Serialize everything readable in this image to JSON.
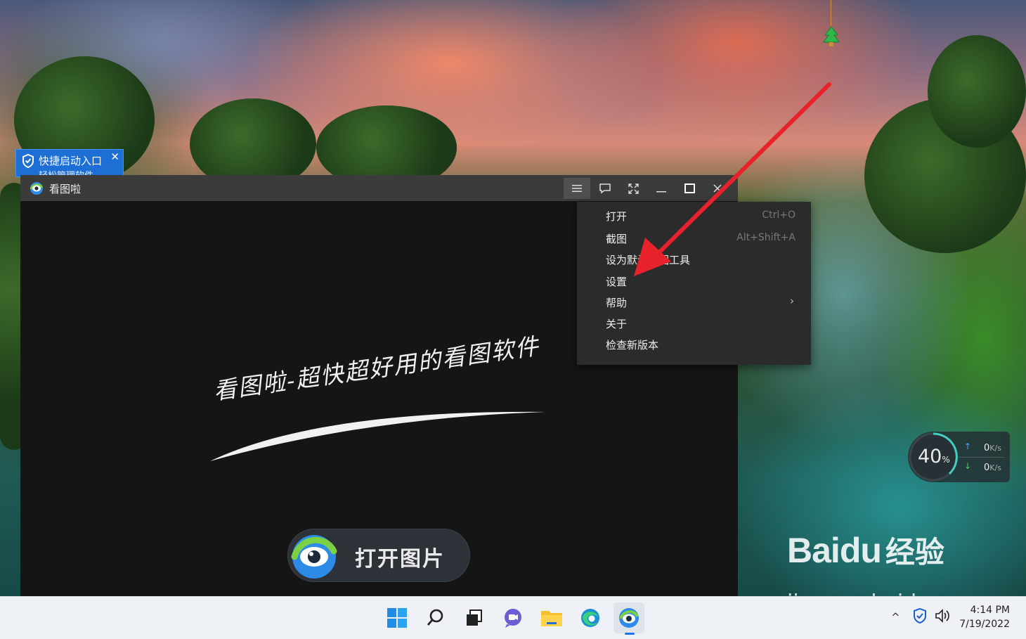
{
  "desktop": {
    "quick_launch": {
      "title": "快捷启动入口",
      "subtitle": "轻松管理软件",
      "close": "✕"
    },
    "net_widget": {
      "cpu_value": "40",
      "cpu_unit": "%",
      "upload_value": "0",
      "upload_unit": "K/s",
      "download_value": "0",
      "download_unit": "K/s",
      "cpu_fraction": 0.4
    },
    "watermark": {
      "brand": "Bai",
      "brand2": "du",
      "cn": "经验",
      "url": "jingyan.baidu.com"
    }
  },
  "window": {
    "title": "看图啦",
    "buttons": {
      "menu": "menu-icon",
      "feedback": "chat-bubble-icon",
      "fullscreen": "fullscreen-icon",
      "minimize": "minimize-icon",
      "maximize": "maximize-icon",
      "close": "close-icon"
    },
    "slogan": "看图啦-超快超好用的看图软件",
    "open_button": "打开图片"
  },
  "menu": {
    "items": [
      {
        "label": "打开",
        "shortcut": "Ctrl+O"
      },
      {
        "label": "截图",
        "shortcut": "Alt+Shift+A"
      },
      {
        "label": "设为默认看图工具",
        "shortcut": ""
      },
      {
        "label": "设置",
        "shortcut": ""
      },
      {
        "label": "帮助",
        "submenu": "›"
      },
      {
        "label": "关于",
        "shortcut": ""
      },
      {
        "label": "检查新版本",
        "shortcut": ""
      }
    ]
  },
  "taskbar": {
    "apps": [
      "windows-start",
      "search",
      "task-view",
      "teams-chat",
      "file-explorer",
      "edge",
      "kantu-viewer"
    ],
    "tray": {
      "chevron": "^",
      "time": "4:14 PM",
      "date": "7/19/2022"
    }
  },
  "colors": {
    "accent": "#1a73e8",
    "annotation": "#e8222a",
    "quick_launch_bg": "#1d6fd6"
  }
}
